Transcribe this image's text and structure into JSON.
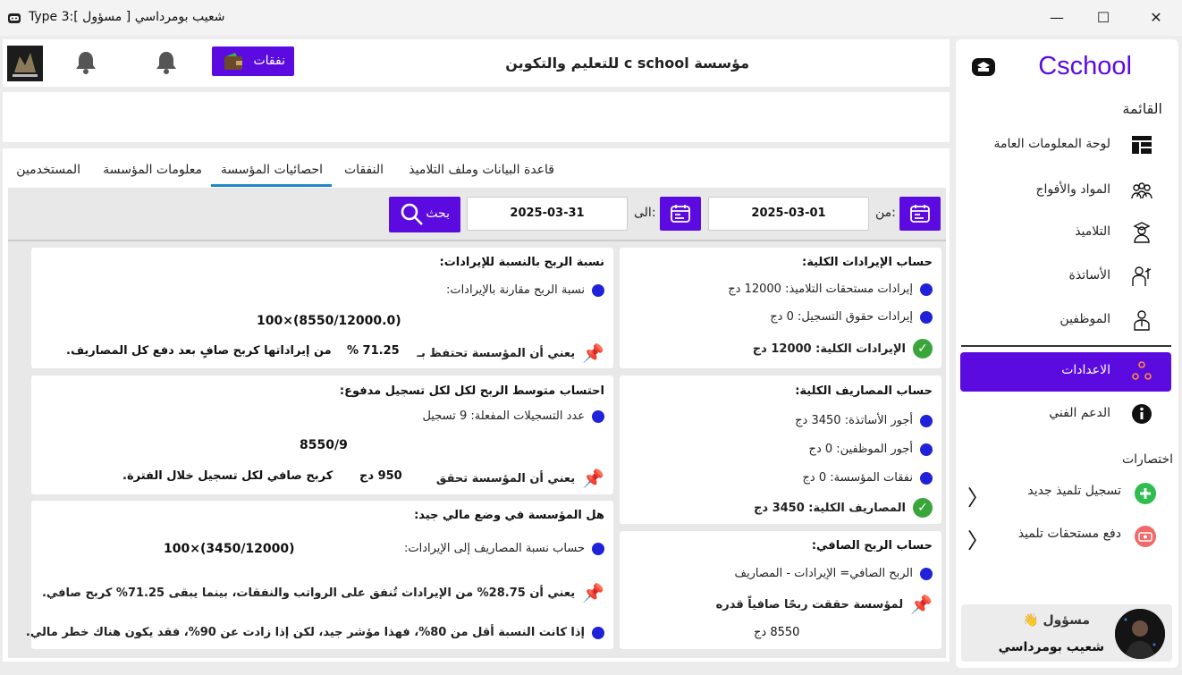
{
  "window": {
    "title": "Type 3:[ مسؤول ] شعيب بومرداسي",
    "minimize": "—",
    "maximize": "☐",
    "close": "✕"
  },
  "sidebar": {
    "logo_text": "Cschool",
    "menu_heading": "القائمة",
    "items": [
      {
        "label": "لوحة المعلومات العامة",
        "icon": "dashboard-icon"
      },
      {
        "label": "المواد والأفواج",
        "icon": "groups-icon"
      },
      {
        "label": "التلاميذ",
        "icon": "student-icon"
      },
      {
        "label": "الأساتذة",
        "icon": "teacher-icon"
      },
      {
        "label": "الموظفين",
        "icon": "employee-icon"
      },
      {
        "label": "الاعدادات",
        "icon": "settings-icon"
      },
      {
        "label": "الدعم الفني",
        "icon": "info-icon"
      }
    ],
    "shortcuts_heading": "اختصارات",
    "shortcuts": [
      {
        "label": "تسجيل تلميذ جديد",
        "icon": "add-icon"
      },
      {
        "label": "دفع مستحقات تلميذ",
        "icon": "payment-icon"
      }
    ],
    "user": {
      "role": "مسؤول 👋",
      "name": "شعيب بومرداسي"
    }
  },
  "topbar": {
    "org_name": "مؤسسة c school للتعليم والتكوين",
    "expenses_label": "نفقات"
  },
  "tabs": [
    "قاعدة البيانات وملف التلاميذ",
    "النفقات",
    "احصائيات المؤسسة",
    "معلومات المؤسسة",
    "المستخدمين"
  ],
  "active_tab": "احصائيات المؤسسة",
  "filter": {
    "from_label": "من:",
    "from_value": "2025-03-01",
    "to_label": "الى:",
    "to_value": "2025-03-31",
    "search_label": "بحث"
  },
  "revenue": {
    "title": "حساب الإيرادات الكلية:",
    "student_dues": "إيرادات مستحقات التلاميذ: 12000 دج",
    "registration": "إيرادات حقوق التسجيل: 0 دج",
    "total": "الإيرادات الكلية: 12000 دج"
  },
  "expenses": {
    "title": "حساب المصاريف الكلية:",
    "teachers": "أجور الأساتذة: 3450 دج",
    "employees": "أجور الموظفين: 0 دج",
    "institution": "نفقات المؤسسة: 0 دج",
    "total": "المصاريف الكلية: 3450 دج"
  },
  "net": {
    "title": "حساب الربح الصافي:",
    "formula": "الربح الصافي= الإيرادات - المصاريف",
    "note": "لمؤسسة حققت ربحًا صافياً قدره",
    "value": "8550 دج"
  },
  "profit_ratio": {
    "title": "نسبة الربح بالنسبة للإيرادات:",
    "desc": "نسبة الربح مقارنة بالإيرادات:",
    "formula": "100×(8550/12000.0)",
    "meaning_a": "يعني أن المؤسسة تحتفظ بـ",
    "percent": "% 71.25",
    "meaning_b": "من إيراداتها كربح صافٍ بعد دفع كل المصاريف."
  },
  "avg_profit": {
    "title": "احتساب متوسط الربح لكل لكل تسجيل مدفوع:",
    "desc": "عدد التسجيلات المفعلة: 9 تسجيل",
    "formula": "8550/9",
    "meaning_a": "يعني أن المؤسسة تحقق",
    "value": "950 دج",
    "meaning_b": "كربح صافي لكل تسجيل خلال الفترة."
  },
  "health": {
    "title": "هل المؤسسة في وضع مالي جيد:",
    "desc": "حساب نسبة المصاريف إلى الإيرادات:",
    "formula": "100×(3450/12000)",
    "meaning": "يعني أن   28.75%   من الإيرادات تُنفق على الرواتب والنفقات، بينما يبقى   71.25%   كربح صافي.",
    "advice": "إذا كانت النسبة أقل من 80%، فهذا مؤشر جيد، لكن إذا زادت عن 90%، فقد يكون هناك خطر مالي."
  }
}
